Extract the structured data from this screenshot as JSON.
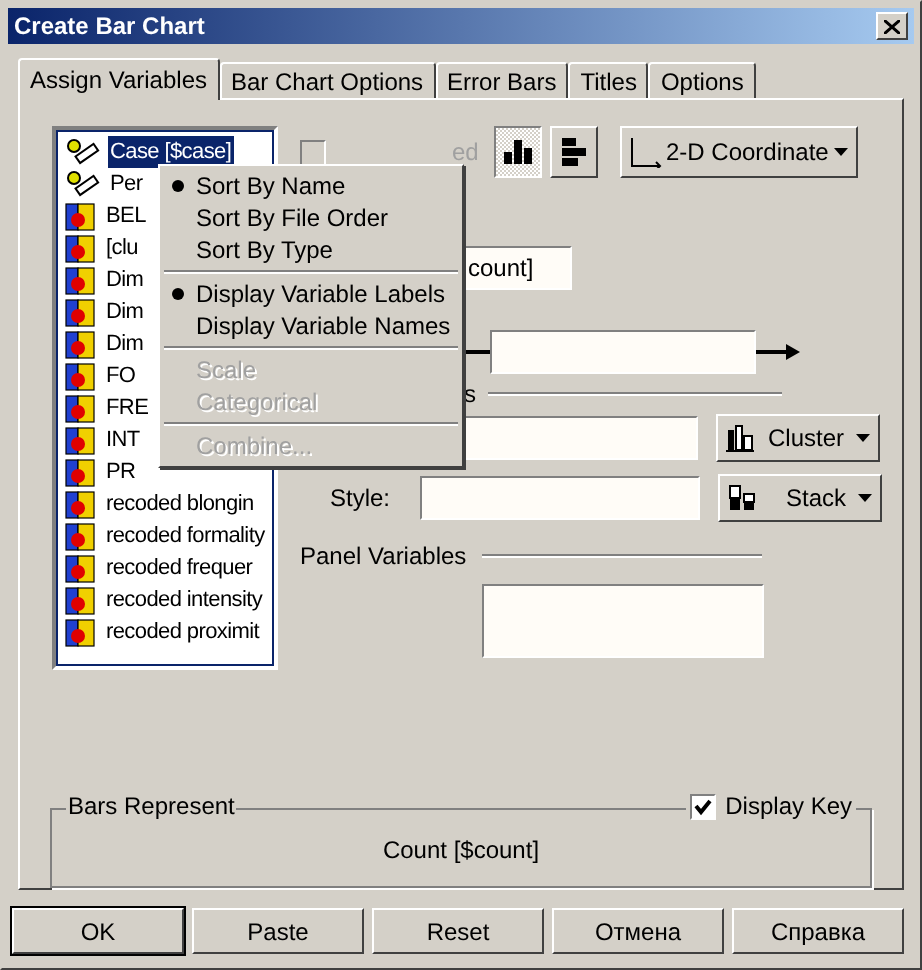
{
  "window": {
    "title": "Create Bar Chart"
  },
  "tabs": [
    {
      "label": "Assign Variables",
      "selected": true
    },
    {
      "label": "Bar Chart Options",
      "selected": false
    },
    {
      "label": "Error Bars",
      "selected": false
    },
    {
      "label": "Titles",
      "selected": false
    },
    {
      "label": "Options",
      "selected": false
    }
  ],
  "variables": [
    {
      "label": "Case [$case]",
      "kind": "scale",
      "selected": true
    },
    {
      "label": "Per",
      "kind": "scale",
      "selected": false
    },
    {
      "label": "BEL",
      "kind": "nominal",
      "selected": false
    },
    {
      "label": " [clu",
      "kind": "nominal",
      "selected": false
    },
    {
      "label": "Dim",
      "kind": "nominal",
      "selected": false
    },
    {
      "label": "Dim",
      "kind": "nominal",
      "selected": false
    },
    {
      "label": "Dim",
      "kind": "nominal",
      "selected": false
    },
    {
      "label": "FO",
      "kind": "nominal",
      "selected": false
    },
    {
      "label": "FRE",
      "kind": "nominal",
      "selected": false
    },
    {
      "label": "INT",
      "kind": "nominal",
      "selected": false
    },
    {
      "label": "PR",
      "kind": "nominal",
      "selected": false
    },
    {
      "label": "recoded blongin",
      "kind": "nominal",
      "selected": false
    },
    {
      "label": "recoded formality",
      "kind": "nominal",
      "selected": false
    },
    {
      "label": "recoded frequer",
      "kind": "nominal",
      "selected": false
    },
    {
      "label": "recoded intensity",
      "kind": "nominal",
      "selected": false
    },
    {
      "label": "recoded proximit",
      "kind": "nominal",
      "selected": false
    }
  ],
  "stacked_checkbox": {
    "label": "ed",
    "checked": false,
    "disabled": true
  },
  "orientation": [
    {
      "kind": "vertical",
      "selected": true
    },
    {
      "kind": "horizontal",
      "selected": false
    }
  ],
  "coordinate_button": "2-D Coordinate",
  "y_field": {
    "value": "count]"
  },
  "legend_label": "s",
  "cluster_button": "Cluster",
  "style_label": "Style:",
  "stack_button": "Stack",
  "panel_variables_label": "Panel Variables",
  "bars_represent": {
    "title": "Bars Represent",
    "value": "Count [$count]",
    "display_key": {
      "label": "Display Key",
      "checked": true
    }
  },
  "context_menu": [
    [
      {
        "label": "Sort By Name",
        "selected": true,
        "disabled": false
      },
      {
        "label": "Sort By File Order",
        "selected": false,
        "disabled": false
      },
      {
        "label": "Sort By Type",
        "selected": false,
        "disabled": false
      }
    ],
    [
      {
        "label": "Display Variable Labels",
        "selected": true,
        "disabled": false
      },
      {
        "label": "Display Variable Names",
        "selected": false,
        "disabled": false
      }
    ],
    [
      {
        "label": "Scale",
        "selected": false,
        "disabled": true
      },
      {
        "label": "Categorical",
        "selected": false,
        "disabled": true
      }
    ],
    [
      {
        "label": "Combine...",
        "selected": false,
        "disabled": true
      }
    ]
  ],
  "buttons": [
    {
      "label": "OK",
      "default": true
    },
    {
      "label": "Paste",
      "default": false
    },
    {
      "label": "Reset",
      "default": false
    },
    {
      "label": "Отмена",
      "default": false
    },
    {
      "label": "Справка",
      "default": false
    }
  ]
}
